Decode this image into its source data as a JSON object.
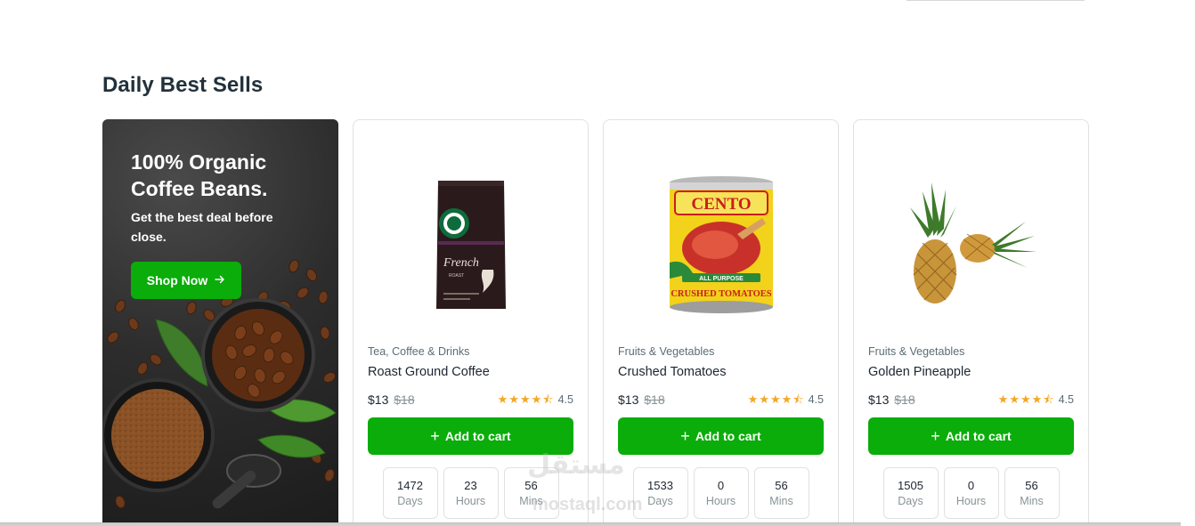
{
  "section": {
    "title": "Daily Best Sells"
  },
  "promo": {
    "title": "100% Organic Coffee Beans.",
    "subtitle": "Get the best deal before close.",
    "button_label": "Shop Now",
    "button_icon": "arrow-right-icon"
  },
  "products": [
    {
      "category": "Tea, Coffee & Drinks",
      "name": "Roast Ground Coffee",
      "price": "$13",
      "old_price": "$18",
      "rating": "4.5",
      "rating_value": 4.5,
      "add_label": "Add to cart",
      "image": "coffee-bag-image",
      "timer": [
        {
          "value": "1472",
          "label": "Days"
        },
        {
          "value": "23",
          "label": "Hours"
        },
        {
          "value": "56",
          "label": "Mins"
        }
      ]
    },
    {
      "category": "Fruits & Vegetables",
      "name": "Crushed Tomatoes",
      "price": "$13",
      "old_price": "$18",
      "rating": "4.5",
      "rating_value": 4.5,
      "add_label": "Add to cart",
      "image": "tomato-can-image",
      "timer": [
        {
          "value": "1533",
          "label": "Days"
        },
        {
          "value": "0",
          "label": "Hours"
        },
        {
          "value": "56",
          "label": "Mins"
        }
      ]
    },
    {
      "category": "Fruits & Vegetables",
      "name": "Golden Pineapple",
      "price": "$13",
      "old_price": "$18",
      "rating": "4.5",
      "rating_value": 4.5,
      "add_label": "Add to cart",
      "image": "pineapple-image",
      "timer": [
        {
          "value": "1505",
          "label": "Days"
        },
        {
          "value": "0",
          "label": "Hours"
        },
        {
          "value": "56",
          "label": "Mins"
        }
      ]
    }
  ],
  "product_images": {
    "coffee_bag": {
      "brand": "French",
      "sub": "ROAST"
    },
    "tomato_can": {
      "brand": "CENTO",
      "tag": "ALL PURPOSE",
      "product": "CRUSHED TOMATOES"
    }
  },
  "watermark": {
    "text": "مستقل",
    "url": "mostaql.com"
  },
  "colors": {
    "accent": "#0aad0a",
    "star": "#f5a623",
    "text": "#1d2530",
    "muted": "#5c6c75"
  }
}
